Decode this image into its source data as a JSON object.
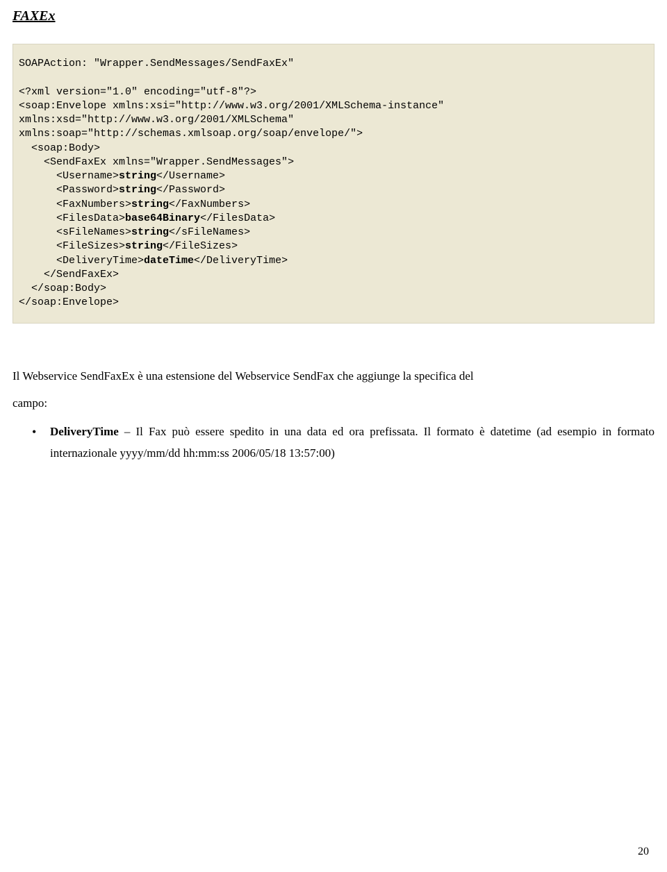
{
  "title": "FAXEx",
  "code": {
    "l1": "SOAPAction: \"Wrapper.SendMessages/SendFaxEx\"",
    "l2": "",
    "l3": "<?xml version=\"1.0\" encoding=\"utf-8\"?>",
    "l4": "<soap:Envelope xmlns:xsi=\"http://www.w3.org/2001/XMLSchema-instance\" ",
    "l5": "xmlns:xsd=\"http://www.w3.org/2001/XMLSchema\" ",
    "l6": "xmlns:soap=\"http://schemas.xmlsoap.org/soap/envelope/\">",
    "l7": "  <soap:Body>",
    "l8": "    <SendFaxEx xmlns=\"Wrapper.SendMessages\">",
    "l9a": "      <Username>",
    "l9b": "string",
    "l9c": "</Username>",
    "l10a": "      <Password>",
    "l10b": "string",
    "l10c": "</Password>",
    "l11a": "      <FaxNumbers>",
    "l11b": "string",
    "l11c": "</FaxNumbers>",
    "l12a": "      <FilesData>",
    "l12b": "base64Binary",
    "l12c": "</FilesData>",
    "l13a": "      <sFileNames>",
    "l13b": "string",
    "l13c": "</sFileNames>",
    "l14a": "      <FileSizes>",
    "l14b": "string",
    "l14c": "</FileSizes>",
    "l15a": "      <DeliveryTime>",
    "l15b": "dateTime",
    "l15c": "</DeliveryTime>",
    "l16": "    </SendFaxEx>",
    "l17": "  </soap:Body>",
    "l18": "</soap:Envelope>"
  },
  "paragraph": {
    "line1": "Il Webservice SendFaxEx è una estensione del Webservice SendFax che aggiunge la specifica del",
    "line2": "campo:"
  },
  "bullet": {
    "bold": "DeliveryTime",
    "rest": " – Il Fax può essere spedito in una data ed ora prefissata. Il formato è datetime (ad esempio in formato internazionale yyyy/mm/dd hh:mm:ss  2006/05/18 13:57:00)"
  },
  "pageNumber": "20"
}
